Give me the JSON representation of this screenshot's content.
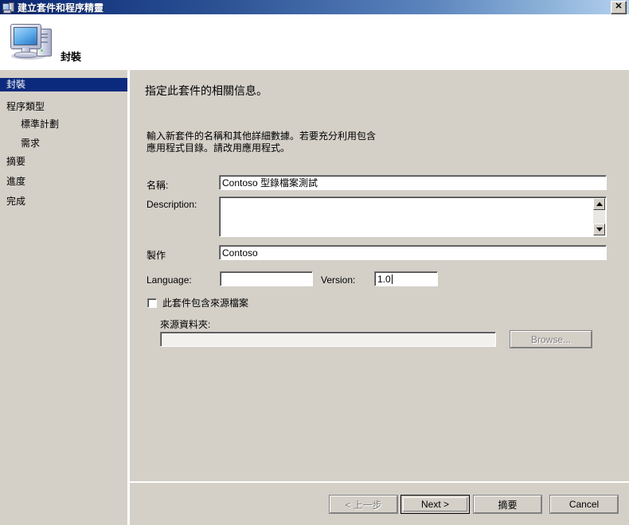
{
  "window": {
    "title": "建立套件和程序精靈",
    "icon": "computer-wizard-icon",
    "close_label": "✕"
  },
  "banner": {
    "title": "封裝",
    "icon": "computer-icon"
  },
  "sidebar": {
    "items": [
      {
        "label": "封裝",
        "indent": false,
        "active": true
      },
      {
        "label": "程序類型",
        "indent": false,
        "active": false
      },
      {
        "label": "標準計劃",
        "indent": true,
        "active": false
      },
      {
        "label": "需求",
        "indent": true,
        "active": false
      },
      {
        "label": "摘要",
        "indent": false,
        "active": false
      },
      {
        "label": "進度",
        "indent": false,
        "active": false
      },
      {
        "label": "完成",
        "indent": false,
        "active": false
      }
    ]
  },
  "content": {
    "heading": "指定此套件的相關信息。",
    "description": "輸入新套件的名稱和其他詳細數據。若要充分利用包含\n應用程式目錄。請改用應用程式。",
    "fields": {
      "name_label": "名稱:",
      "name_value": "Contoso 型錄檔案測試",
      "description_label": "Description:",
      "description_value": "",
      "publisher_label": "製作",
      "publisher_value": "Contoso",
      "language_label": "Language:",
      "language_value": "",
      "version_label": "Version:",
      "version_value": "1.0",
      "contains_source_label": "此套件包含來源檔案",
      "contains_source_checked": false,
      "source_folder_label": "來源資料夾:",
      "source_folder_value": "",
      "browse_label": "Browse..."
    }
  },
  "footer": {
    "back_label": "< 上一步",
    "next_label": "Next >",
    "summary_label": "摘要",
    "cancel_label": "Cancel"
  },
  "colors": {
    "titlebar_start": "#0a246a",
    "titlebar_end": "#b6d1ef",
    "sidebar_selected": "#0c2a7d",
    "dialog_face": "#d4d0c8",
    "banner_bg": "#ffffff"
  }
}
